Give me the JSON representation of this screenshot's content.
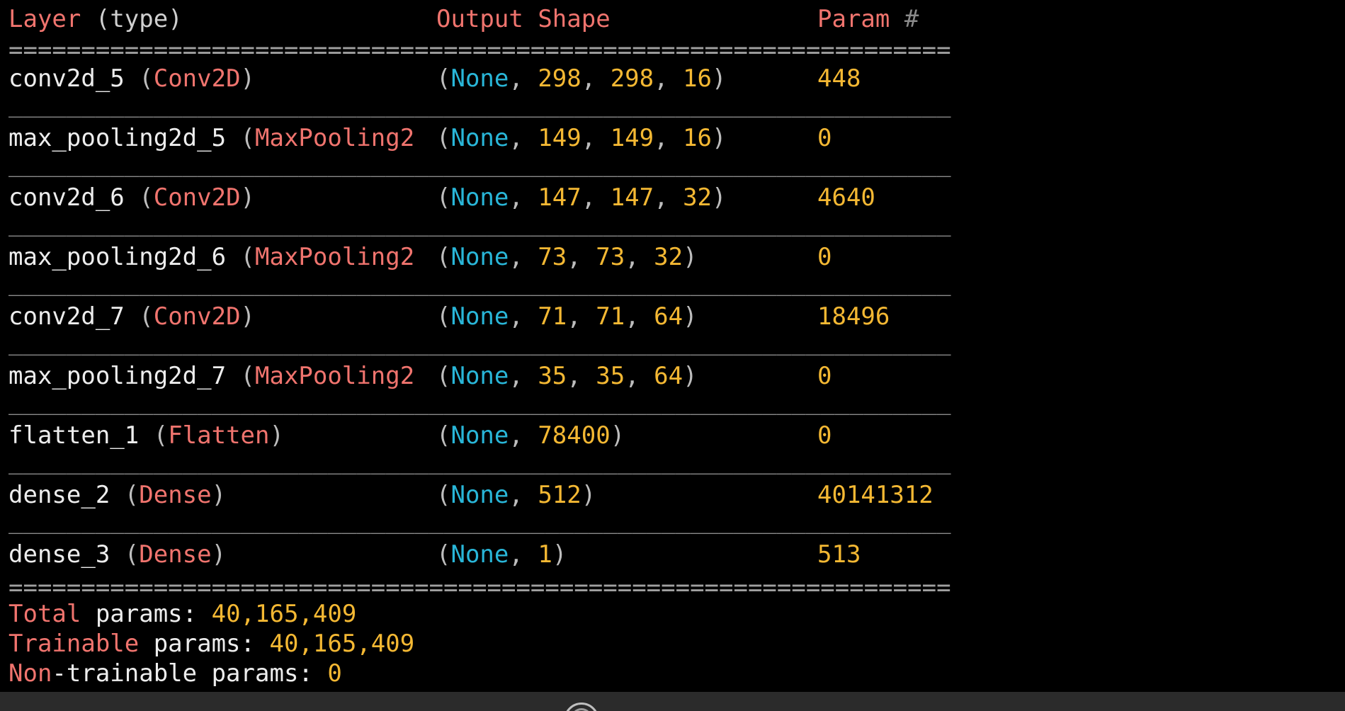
{
  "header": {
    "layer": "Layer",
    "type": "type",
    "output": "Output",
    "shape": "Shape",
    "param": "Param",
    "hash": "#"
  },
  "separator_eq": "=================================================================",
  "separator_dash": "_________________________________________________________________",
  "layers": [
    {
      "name": "conv2d_5",
      "type": "Conv2D",
      "shape": [
        "None",
        "298",
        "298",
        "16"
      ],
      "params": "448"
    },
    {
      "name": "max_pooling2d_5",
      "type": "MaxPooling2",
      "shape": [
        "None",
        "149",
        "149",
        "16"
      ],
      "params": "0"
    },
    {
      "name": "conv2d_6",
      "type": "Conv2D",
      "shape": [
        "None",
        "147",
        "147",
        "32"
      ],
      "params": "4640"
    },
    {
      "name": "max_pooling2d_6",
      "type": "MaxPooling2",
      "shape": [
        "None",
        "73",
        "73",
        "32"
      ],
      "params": "0"
    },
    {
      "name": "conv2d_7",
      "type": "Conv2D",
      "shape": [
        "None",
        "71",
        "71",
        "64"
      ],
      "params": "18496"
    },
    {
      "name": "max_pooling2d_7",
      "type": "MaxPooling2",
      "shape": [
        "None",
        "35",
        "35",
        "64"
      ],
      "params": "0"
    },
    {
      "name": "flatten_1",
      "type": "Flatten",
      "shape": [
        "None",
        "78400"
      ],
      "params": "0"
    },
    {
      "name": "dense_2",
      "type": "Dense",
      "shape": [
        "None",
        "512"
      ],
      "params": "40141312"
    },
    {
      "name": "dense_3",
      "type": "Dense",
      "shape": [
        "None",
        "1"
      ],
      "params": "513"
    }
  ],
  "summary": {
    "total_label_1": "Total",
    "total_label_2": " params: ",
    "total_value": "40,165,409",
    "trainable_label_1": "Trainable",
    "trainable_label_2": " params: ",
    "trainable_value": "40,165,409",
    "nontrainable_label_1": "Non",
    "nontrainable_label_2": "-trainable params: ",
    "nontrainable_value": "0"
  },
  "colors": {
    "background": "#000000",
    "keyword_red": "#f0746e",
    "none_cyan": "#29b6d8",
    "number_yellow": "#f4b833",
    "text_white": "#ededed"
  }
}
